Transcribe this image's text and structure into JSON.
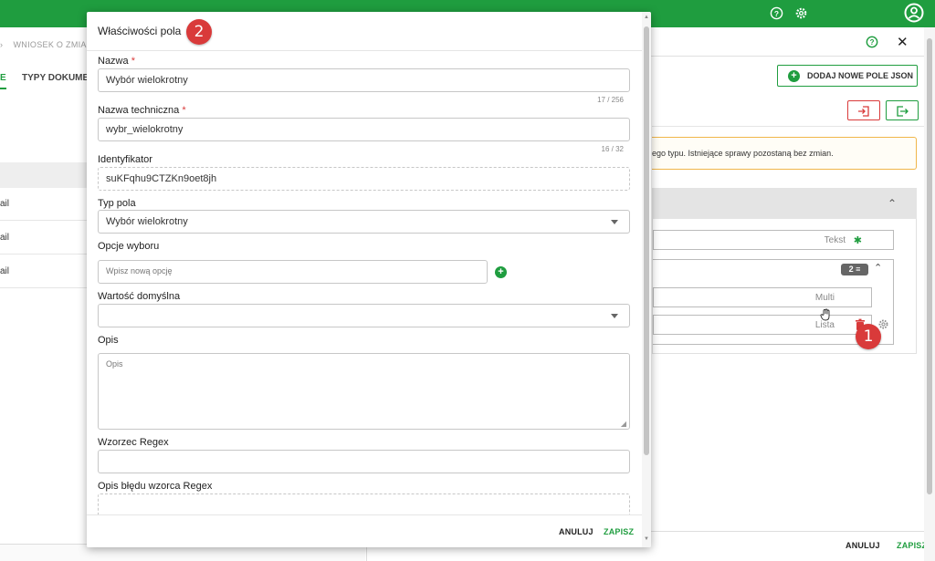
{
  "topbar": {
    "help_icon": "?",
    "gear_icon": "⚙",
    "user_icon": "◯"
  },
  "left": {
    "breadcrumb": "WNIOSEK O ZMIANĘ ...",
    "breadcrumb_chevron": "›",
    "tab_partial": "E",
    "tab_docs": "TYPY DOKUMENT",
    "rows": [
      "ail",
      "ail",
      "ail"
    ]
  },
  "right": {
    "help_icon": "?",
    "close_icon": "✕",
    "add_json_label": "DODAJ NOWE POLE JSON",
    "import_icon": "⇥",
    "export_icon": "⇥",
    "notice": "ego typu. Istniejące sprawy pozostaną bez zmian.",
    "collapse_icon": "⌃",
    "field_text_label": "Tekst",
    "field_text_icon": "✱",
    "group_count": "2",
    "group_icon": "≡",
    "field_multi": "Multi",
    "field_lista": "Lista",
    "footer_cancel": "ANULUJ",
    "footer_save": "ZAPISZ",
    "marker_1": "1"
  },
  "dialog": {
    "title": "Właściwości pola",
    "marker_2": "2",
    "name_label": "Nazwa",
    "name_value": "Wybór wielokrotny",
    "name_counter": "17 / 256",
    "tech_label": "Nazwa techniczna",
    "tech_value": "wybr_wielokrotny",
    "tech_counter": "16 / 32",
    "id_label": "Identyfikator",
    "id_value": "suKFqhu9CTZKn9oet8jh",
    "type_label": "Typ pola",
    "type_value": "Wybór wielokrotny",
    "options_label": "Opcje wyboru",
    "options_placeholder": "Wpisz nową opcję",
    "default_label": "Wartość domyślna",
    "desc_label": "Opis",
    "desc_placeholder": "Opis",
    "regex_label": "Wzorzec Regex",
    "regex_error_label": "Opis błędu wzorca Regex",
    "cancel_label": "ANULUJ",
    "save_label": "ZAPISZ",
    "required_mark": "*"
  },
  "colors": {
    "accent": "#1f9d3f",
    "danger": "#d93a3a",
    "warning": "#f0b64a"
  }
}
